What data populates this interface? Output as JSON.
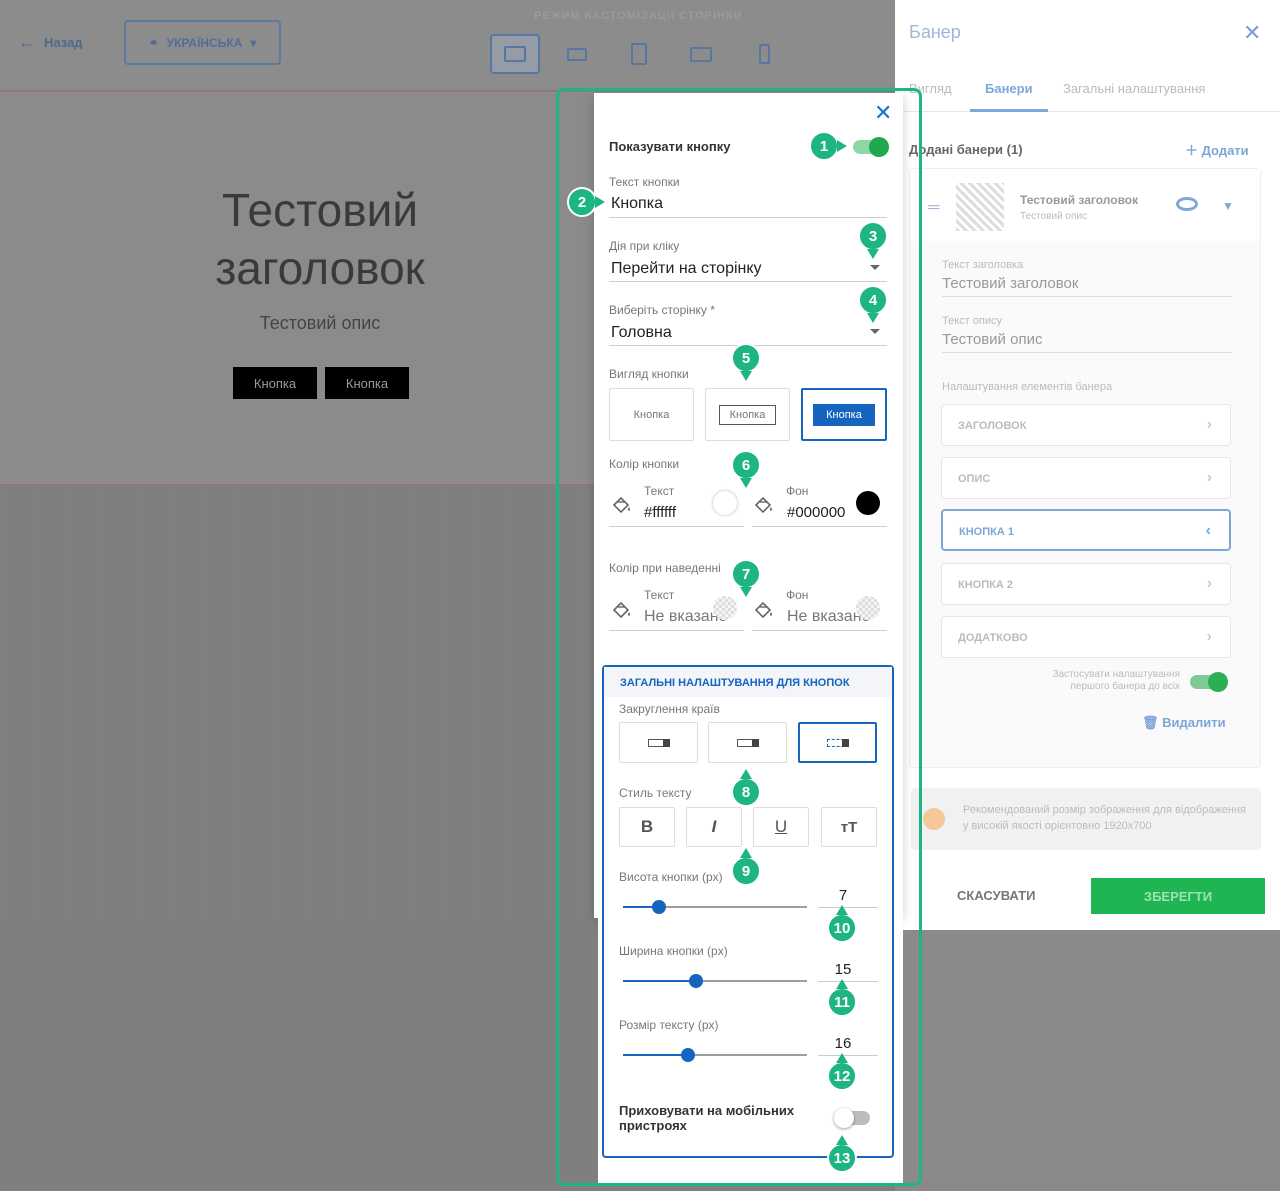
{
  "editor": {
    "back_label": "Назад",
    "language_label": "УКРАЇНСЬКА",
    "mode_title": "РЕЖИМ КАСТОМІЗАЦІЇ СТОРІНКИ",
    "devices": [
      "desktop-icon",
      "laptop-icon",
      "tablet-icon",
      "tablet-landscape-icon",
      "mobile-icon"
    ],
    "banner": {
      "title_line1": "Тестовий",
      "title_line2": "заголовок",
      "description": "Тестовий опис",
      "button1": "Кнопка",
      "button2": "Кнопка"
    }
  },
  "right_panel": {
    "title": "Банер",
    "tabs": [
      "Вигляд",
      "Банери",
      "Загальні налаштування"
    ],
    "active_tab": "Банери",
    "added_label": "Додані банери (1)",
    "add_label": "Додати",
    "card": {
      "name": "Тестовий заголовок",
      "sub": "Тестовий опис",
      "title_field_label": "Текст заголовка",
      "title_field_value": "Тестовий заголовок",
      "desc_field_label": "Текст опису",
      "desc_field_value": "Тестовий опис",
      "elements_label": "Налаштування елементів банера",
      "items": [
        "ЗАГОЛОВОК",
        "ОПИС",
        "КНОПКА 1",
        "КНОПКА 2",
        "ДОДАТКОВО"
      ],
      "active_item": "КНОПКА 1",
      "apply_first_label": "Застосувати налаштування першого банера до всіх",
      "delete_label": "Видалити"
    },
    "info_text": "Рекомендований розмір зображення для відображення у високій якості орієнтовно 1920x700",
    "cancel_label": "СКАСУВАТИ",
    "save_label": "ЗБЕРЕГТИ"
  },
  "popup": {
    "show_button_label": "Показувати кнопку",
    "show_button_on": true,
    "button_text_label": "Текст кнопки",
    "button_text_value": "Кнопка",
    "click_action_label": "Дія при кліку",
    "click_action_value": "Перейти на сторінку",
    "select_page_label": "Виберіть сторінку *",
    "select_page_value": "Головна",
    "button_view_label": "Вигляд кнопки",
    "button_view_options": [
      "Кнопка",
      "Кнопка",
      "Кнопка"
    ],
    "button_color_label": "Колір кнопки",
    "text_label": "Текст",
    "bg_label": "Фон",
    "text_color_value": "#ffffff",
    "bg_color_value": "#000000",
    "hover_color_label": "Колір при наведенні",
    "not_set": "Не вказано",
    "general": {
      "title": "ЗАГАЛЬНІ НАЛАШТУВАННЯ ДЛЯ КНОПОК",
      "rounding_label": "Закруглення країв",
      "text_style_label": "Стиль тексту",
      "text_style_options": [
        "B",
        "I",
        "U",
        "тT"
      ],
      "height_label": "Висота кнопки (px)",
      "height_value": "7",
      "width_label": "Ширина кнопки (px)",
      "width_value": "15",
      "font_size_label": "Розмір тексту (px)",
      "font_size_value": "16",
      "hide_mobile_label_1": "Приховувати на мобільних",
      "hide_mobile_label_2": "пристроях",
      "hide_mobile_on": false
    }
  },
  "badges": [
    "1",
    "2",
    "3",
    "4",
    "5",
    "6",
    "7",
    "8",
    "9",
    "10",
    "11",
    "12",
    "13"
  ],
  "colors": {
    "accent": "#1565c0",
    "badge": "#1db584",
    "toggle_on": "#1fa84f"
  }
}
